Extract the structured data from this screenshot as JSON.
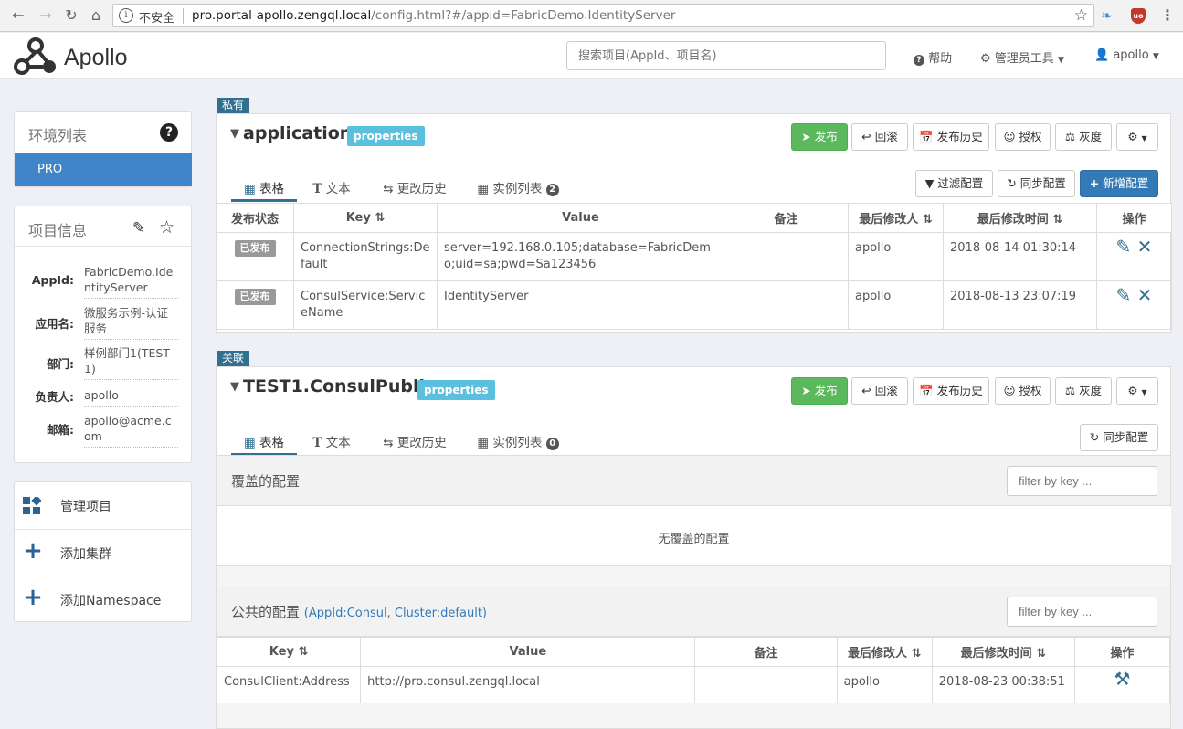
{
  "browser": {
    "insecure_label": "不安全",
    "url_host": "pro.portal-apollo.zengql.local",
    "url_path": "/config.html?#/appid=FabricDemo.IdentityServer"
  },
  "header": {
    "logo_text": "Apollo",
    "search_placeholder": "搜索项目(AppId、项目名)",
    "help_label": "帮助",
    "admin_tools_label": "管理员工具",
    "user_label": "apollo"
  },
  "env_panel": {
    "title": "环境列表",
    "envs": [
      "PRO"
    ]
  },
  "project_info": {
    "title": "项目信息",
    "rows": [
      {
        "label": "AppId:",
        "value": "FabricDemo.IdentityServer"
      },
      {
        "label": "应用名:",
        "value": "微服务示例-认证服务"
      },
      {
        "label": "部门:",
        "value": "样例部门1(TEST1)"
      },
      {
        "label": "负责人:",
        "value": "apollo"
      },
      {
        "label": "邮箱:",
        "value": "apollo@acme.com"
      }
    ]
  },
  "left_menu": {
    "items": [
      "管理项目",
      "添加集群",
      "添加Namespace"
    ]
  },
  "ns1": {
    "tag": "私有",
    "name": "application",
    "format": "properties",
    "buttons": {
      "publish": "发布",
      "rollback": "回滚",
      "history": "发布历史",
      "grant": "授权",
      "gray": "灰度"
    },
    "tabs": {
      "table": "表格",
      "text": "文本",
      "history": "更改历史",
      "instances": "实例列表",
      "instance_count": "2"
    },
    "actions": {
      "filter": "过滤配置",
      "sync": "同步配置",
      "add": "新增配置"
    },
    "columns": [
      "发布状态",
      "Key",
      "Value",
      "备注",
      "最后修改人",
      "最后修改时间",
      "操作"
    ],
    "rows": [
      {
        "status": "已发布",
        "key": "ConnectionStrings:Default",
        "value": "server=192.168.0.105;database=FabricDemo;uid=sa;pwd=Sa123456",
        "comment": "",
        "modifier": "apollo",
        "time": "2018-08-14 01:30:14"
      },
      {
        "status": "已发布",
        "key": "ConsulService:ServiceName",
        "value": "IdentityServer",
        "comment": "",
        "modifier": "apollo",
        "time": "2018-08-13 23:07:19"
      }
    ]
  },
  "ns2": {
    "tag": "关联",
    "name": "TEST1.ConsulPublic",
    "format": "properties",
    "buttons": {
      "publish": "发布",
      "rollback": "回滚",
      "history": "发布历史",
      "grant": "授权",
      "gray": "灰度"
    },
    "tabs": {
      "table": "表格",
      "text": "文本",
      "history": "更改历史",
      "instances": "实例列表",
      "instance_count": "0"
    },
    "actions": {
      "sync": "同步配置"
    },
    "override_title": "覆盖的配置",
    "filter_placeholder": "filter by key ...",
    "no_override": "无覆盖的配置",
    "public_title": "公共的配置",
    "public_sub": "(AppId:Consul, Cluster:default)",
    "columns": [
      "Key",
      "Value",
      "备注",
      "最后修改人",
      "最后修改时间",
      "操作"
    ],
    "rows": [
      {
        "key": "ConsulClient:Address",
        "value": "http://pro.consul.zengql.local",
        "comment": "",
        "modifier": "apollo",
        "time": "2018-08-23 00:38:51"
      }
    ]
  }
}
